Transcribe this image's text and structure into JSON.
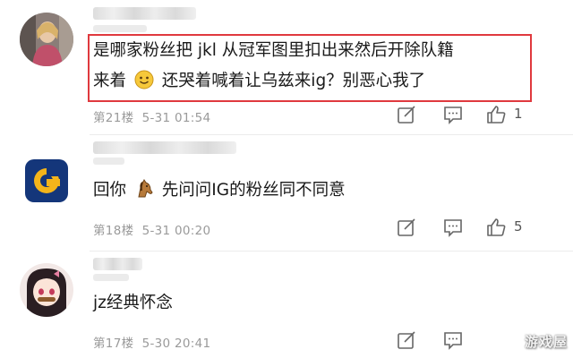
{
  "comments": [
    {
      "text_line1": "是哪家粉丝把 jkl 从冠军图里扣出来然后开除队籍",
      "text_line2_a": "来着",
      "text_line2_b": "还哭着喊着让乌兹来ig？别恶心我了",
      "floor": "第21楼",
      "time": "5-31 01:54",
      "likes": "1",
      "emoji": "smile-emoji",
      "avatar": "user-photo-avatar",
      "highlighted": true
    },
    {
      "text_a": "回你",
      "text_b": "先问问IG的粉丝同不同意",
      "floor": "第18楼",
      "time": "5-31 00:20",
      "likes": "5",
      "emoji": "horse-emoji",
      "avatar": "g-logo-avatar"
    },
    {
      "text": "jz经典怀念",
      "floor": "第17楼",
      "time": "5-30 20:41",
      "avatar": "anime-girl-avatar"
    }
  ],
  "watermark": "游戏屋",
  "colors": {
    "highlight": "#e0393e",
    "meta": "#9a9a9a",
    "g_logo_blue": "#14367a",
    "g_logo_yellow": "#f4b41a"
  }
}
